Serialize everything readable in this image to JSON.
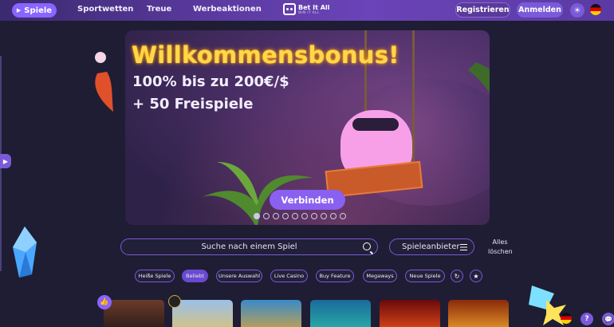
{
  "topbar": {
    "nav_active": "Spiele",
    "nav_links": [
      "Sportwetten",
      "Treue",
      "Werbeaktionen"
    ],
    "logo_name": "Bet It All",
    "logo_tagline": "WIN IT ALL",
    "register_label": "Registrieren",
    "login_label": "Anmelden"
  },
  "banner": {
    "title": "Willkommensbonus!",
    "line1": "100% bis zu 200€/$",
    "line2": "+ 50 Freispiele",
    "cta": "Verbinden",
    "slide_count": 10,
    "active_slide": 0
  },
  "search": {
    "placeholder": "Suche nach einem Spiel",
    "provider_label": "Spieleanbieter",
    "clear_label": "Alles löschen"
  },
  "chips": [
    "Heiße Spiele",
    "Beliebt",
    "Unsere Auswahl",
    "Live Casino",
    "Buy Feature",
    "Megaways",
    "Neue Spiele"
  ],
  "active_chip": "Beliebt",
  "colors": {
    "accent": "#8a64ff",
    "background": "#1f1d33",
    "title_gold": "#ffd84a"
  },
  "icons": [
    "play-icon",
    "sun-icon",
    "flag-de-icon",
    "search-icon",
    "filter-icon",
    "history-icon",
    "star-icon",
    "help-icon",
    "chat-icon",
    "thumbs-up-icon"
  ]
}
